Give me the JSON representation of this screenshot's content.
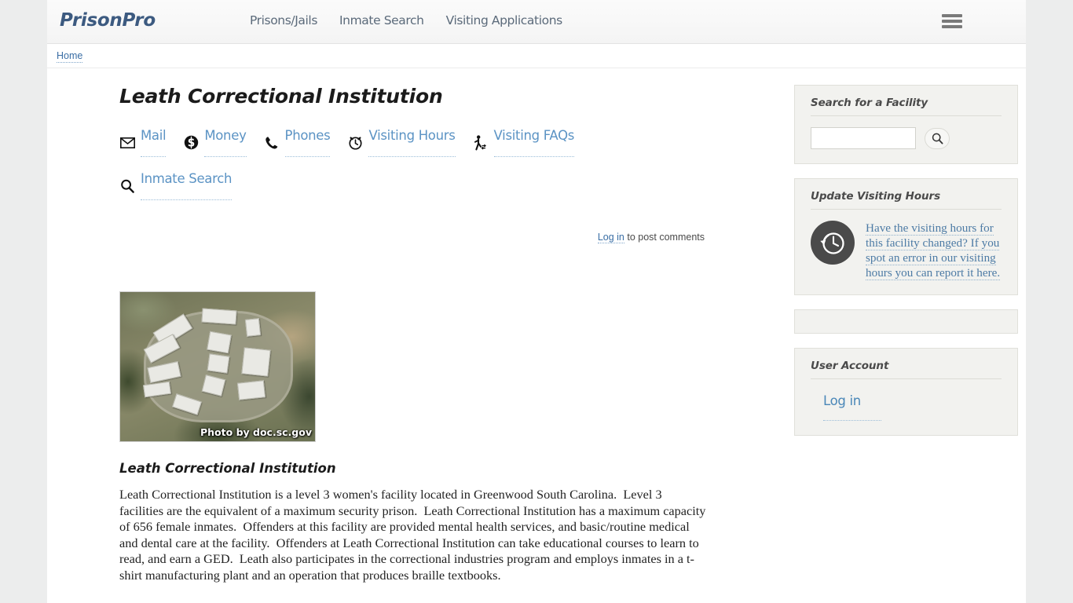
{
  "header": {
    "logo": "PrisonPro",
    "nav": [
      {
        "label": "Prisons/Jails"
      },
      {
        "label": "Inmate Search"
      },
      {
        "label": "Visiting Applications"
      }
    ],
    "menu_icon": "hamburger-icon"
  },
  "breadcrumb": {
    "home": "Home"
  },
  "main": {
    "page_title": "Leath Correctional Institution",
    "quick_links": [
      {
        "label": "Mail",
        "icon": "mail-icon"
      },
      {
        "label": "Money",
        "icon": "money-icon"
      },
      {
        "label": "Phones",
        "icon": "phone-icon"
      },
      {
        "label": "Visiting Hours",
        "icon": "alarm-clock-icon"
      },
      {
        "label": "Visiting FAQs",
        "icon": "walking-person-icon"
      },
      {
        "label": "Inmate Search",
        "icon": "search-icon"
      }
    ],
    "comments": {
      "login_label": "Log in",
      "suffix": " to post comments"
    },
    "photo": {
      "credit": "Photo by doc.sc.gov"
    },
    "article": {
      "heading": "Leath Correctional Institution",
      "body": "Leath Correctional Institution is a level 3 women's facility located in Greenwood South Carolina.  Level 3 facilities are the equivalent of a maximum security prison.  Leath Correctional Institution has a maximum capacity of 656 female inmates.  Offenders at this facility are provided mental health services, and basic/routine medical and dental care at the facility.  Offenders at Leath Correctional Institution can take educational courses to learn to read, and earn a GED.  Leath also participates in the correctional industries program and employs inmates in a t-shirt manufacturing plant and an operation that produces braille textbooks."
    }
  },
  "sidebar": {
    "search_panel": {
      "title": "Search for a Facility",
      "input_value": "",
      "placeholder": "",
      "button_icon": "search-icon"
    },
    "visiting_hours_panel": {
      "title": "Update Visiting Hours",
      "icon": "clock-rewind-icon",
      "link_text": "Have the visiting hours for this facility changed?  If you spot an error in our visiting hours you can report it here."
    },
    "empty_panel": {
      "content": ""
    },
    "user_account_panel": {
      "title": "User Account",
      "login_label": "Log in"
    }
  },
  "colors": {
    "page_bg": "#eceded",
    "content_bg": "#ffffff",
    "logo": "#3c5a80",
    "link": "#5b93c4",
    "panel_bg": "#f2f2ef",
    "text": "#222222"
  }
}
